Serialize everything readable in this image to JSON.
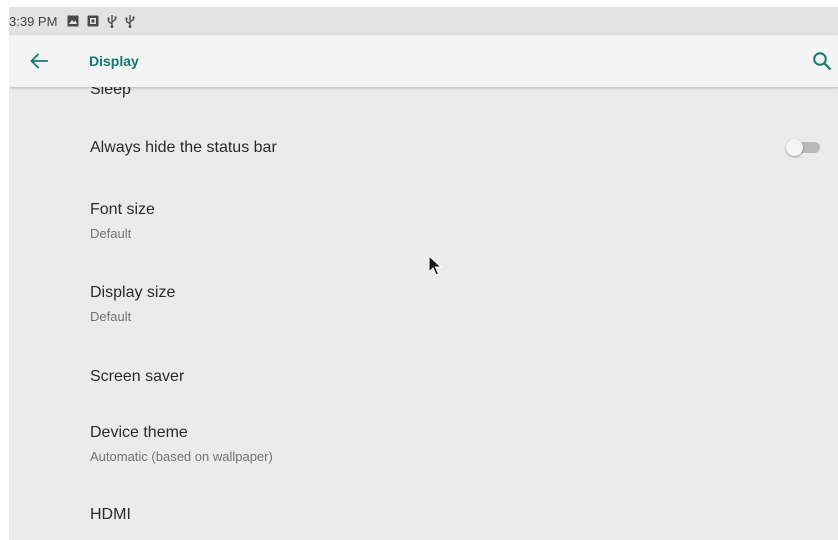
{
  "status_bar": {
    "time": "3:39 PM",
    "icons": [
      "image-icon",
      "photo-icon",
      "usb-icon",
      "usb-icon"
    ]
  },
  "app_bar": {
    "title": "Display",
    "back_icon": "arrow-left-icon",
    "search_icon": "search-icon"
  },
  "colors": {
    "accent": "#0d7d6f",
    "background": "#ebebeb",
    "app_bar": "#f4f4f4"
  },
  "settings": {
    "sleep": {
      "title": "Sleep"
    },
    "hide_status_bar": {
      "title": "Always hide the status bar",
      "toggle_on": false
    },
    "font_size": {
      "title": "Font size",
      "summary": "Default"
    },
    "display_size": {
      "title": "Display size",
      "summary": "Default"
    },
    "screen_saver": {
      "title": "Screen saver"
    },
    "device_theme": {
      "title": "Device theme",
      "summary": "Automatic (based on wallpaper)"
    },
    "hdmi": {
      "title": "HDMI"
    }
  }
}
